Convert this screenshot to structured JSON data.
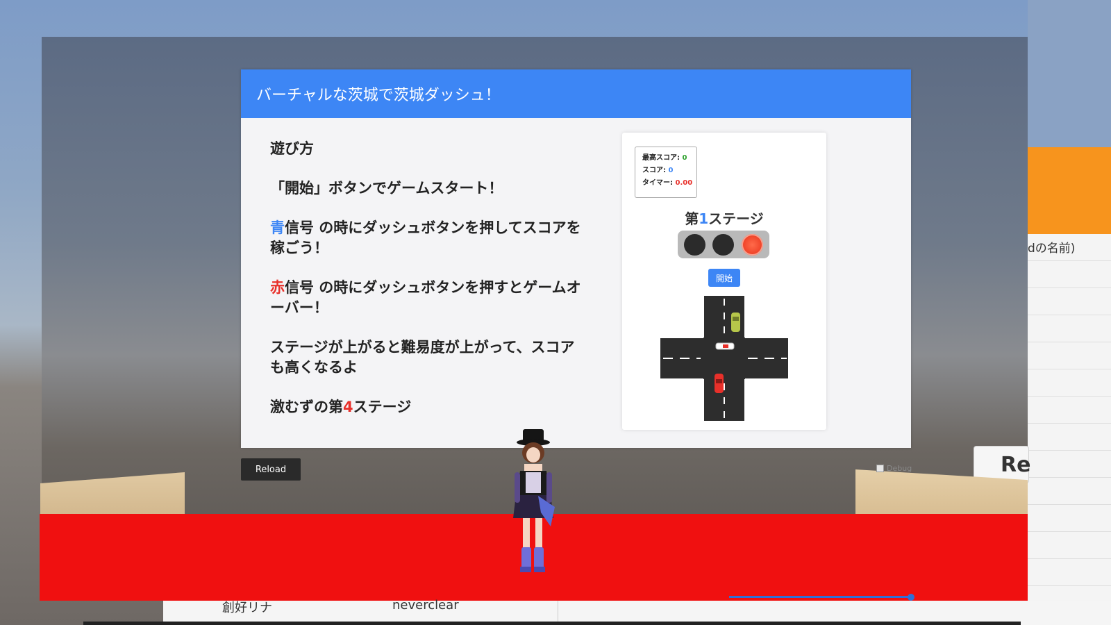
{
  "panel": {
    "title": "バーチャルな茨城で茨城ダッシュ！"
  },
  "instructions": {
    "heading": "遊び方",
    "line1": "「開始」ボタンでゲームスタート！",
    "line2_highlight": "青",
    "line2_rest": "信号 の時にダッシュボタンを押してスコアを稼ごう！",
    "line3_highlight": "赤",
    "line3_rest": "信号 の時にダッシュボタンを押すとゲームオーバー！",
    "line4": "ステージが上がると難易度が上がって、スコアも高くなるよ",
    "line5_pre": "激むずの第",
    "line5_num": "4",
    "line5_post": "ステージ"
  },
  "game": {
    "best_score_label": "最高スコア: ",
    "best_score_value": "0",
    "score_label": "スコア: ",
    "score_value": "0",
    "timer_label": "タイマー: ",
    "timer_value": "0.00",
    "stage_pre": "第",
    "stage_num": "1",
    "stage_post": "ステージ",
    "signal_state": "red",
    "start_label": "開始"
  },
  "controls": {
    "reload_label": "Reload",
    "debug_label": "Debug"
  },
  "background": {
    "right_sheet_header": "dの名前)",
    "re_button_label": "Re",
    "bottom_name": "創好リナ",
    "bottom_value": "neverclear"
  },
  "colors": {
    "header_blue": "#3d86f5",
    "highlight_red": "#e8302a",
    "floor_red": "#f01010",
    "orange": "#f7941d"
  }
}
